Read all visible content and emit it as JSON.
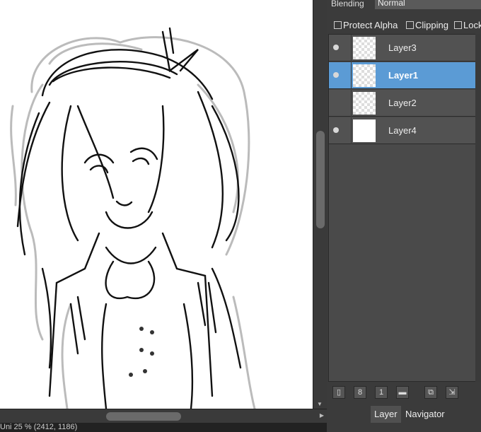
{
  "status": {
    "text": "Uni 25 % (2412, 1186)"
  },
  "layer_panel": {
    "blending_label": "Blending",
    "blending_value": "Normal",
    "options": {
      "protect_alpha": "Protect Alpha",
      "clipping": "Clipping",
      "lock": "Lock"
    },
    "layers": [
      {
        "name": "Layer3",
        "visible": true,
        "selected": false
      },
      {
        "name": "Layer1",
        "visible": true,
        "selected": true
      },
      {
        "name": "Layer2",
        "visible": false,
        "selected": false
      },
      {
        "name": "Layer4",
        "visible": true,
        "selected": false
      }
    ],
    "toolbar_icons": [
      "new-layer-icon",
      "new-8bit-layer-icon",
      "new-1bit-layer-icon",
      "new-folder-icon",
      "duplicate-layer-icon",
      "merge-layer-icon"
    ],
    "tabs": {
      "layer": "Layer",
      "navigator": "Navigator"
    }
  },
  "colors": {
    "selected_row": "#5b9bd5",
    "panel_bg": "#3b3b3b"
  }
}
